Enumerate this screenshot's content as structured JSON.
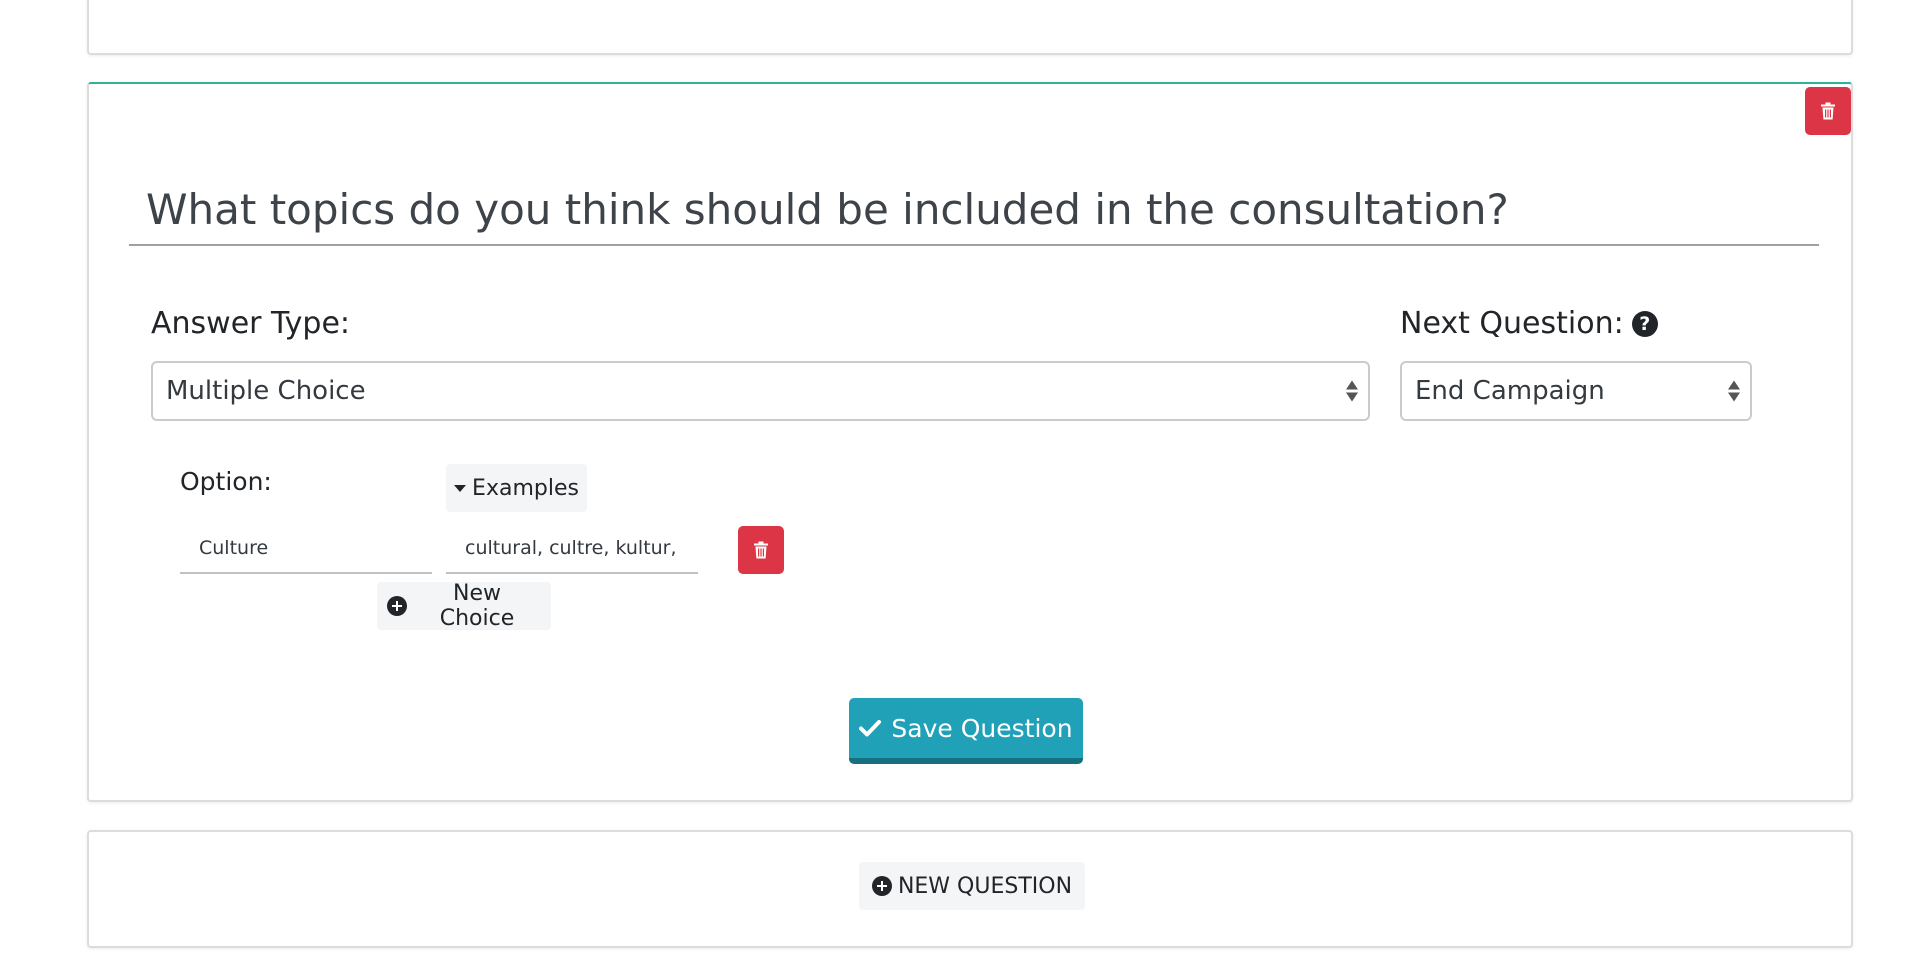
{
  "question": {
    "title": "What topics do you think should be included in the consultation?"
  },
  "answer_type": {
    "label": "Answer Type:",
    "selected": "Multiple Choice"
  },
  "next_question": {
    "label": "Next Question:",
    "selected": "End Campaign",
    "help_glyph": "?"
  },
  "options": {
    "label": "Option:",
    "examples_toggle": "Examples",
    "choices": [
      {
        "value": "Culture",
        "examples": "cultural, cultre, kultur, clu"
      }
    ],
    "new_choice": "New Choice"
  },
  "save_button": "Save Question",
  "new_question_button": "NEW QUESTION",
  "colors": {
    "danger": "#dc3545",
    "info": "#21a1b8",
    "accent_border": "#2eb398"
  },
  "icons": [
    "trash-icon",
    "caret-down-icon",
    "plus-circle-icon",
    "check-icon",
    "question-circle-icon",
    "select-arrows-icon"
  ]
}
